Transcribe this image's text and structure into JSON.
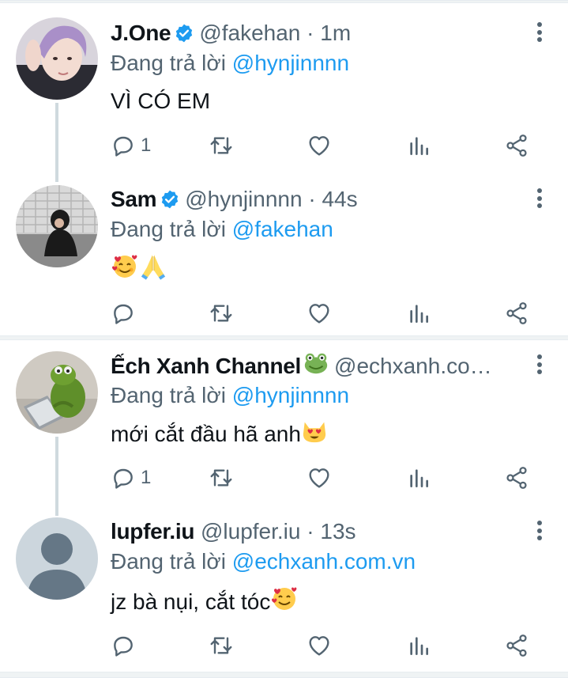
{
  "colors": {
    "accent": "#1d9bf0",
    "secondary_text": "#536471",
    "thread_line": "#cfd9de",
    "verified": "#1d9bf0"
  },
  "tweets": [
    {
      "name": "J.One",
      "verified": true,
      "handle": "@fakehan",
      "time": "· 1m",
      "reply_prefix": "Đang trả lời",
      "reply_to": "@hynjinnnn",
      "text": "VÌ CÓ EM",
      "reply_count": "1",
      "avatar": "photo-person-purple-hair"
    },
    {
      "name": "Sam",
      "verified": true,
      "handle": "@hynjinnnn",
      "time": "· 44s",
      "reply_prefix": "Đang trả lời",
      "reply_to": "@fakehan",
      "text": "",
      "emojis": [
        "smiling-face-with-hearts",
        "folded-hands"
      ],
      "reply_count": "",
      "avatar": "photo-person-crouching"
    },
    {
      "name": "Ếch Xanh Channel",
      "verified": false,
      "handle": "@echxanh.co…",
      "time": "",
      "reply_prefix": "Đang trả lời",
      "reply_to": "@hynjinnnn",
      "text": "mới cắt đầu hã anh",
      "emojis": [
        "heart-eyes-cat"
      ],
      "name_emoji": "frog",
      "reply_count": "1",
      "avatar": "photo-kermit-laptop"
    },
    {
      "name": "lupfer.iu",
      "verified": false,
      "handle": "@lupfer.iu",
      "time": "· 13s",
      "reply_prefix": "Đang trả lời",
      "reply_to": "@echxanh.com.vn",
      "text": "jz bà nụi, cắt tóc",
      "emojis": [
        "smiling-face-with-hearts"
      ],
      "reply_count": "",
      "avatar": "default-avatar"
    }
  ]
}
